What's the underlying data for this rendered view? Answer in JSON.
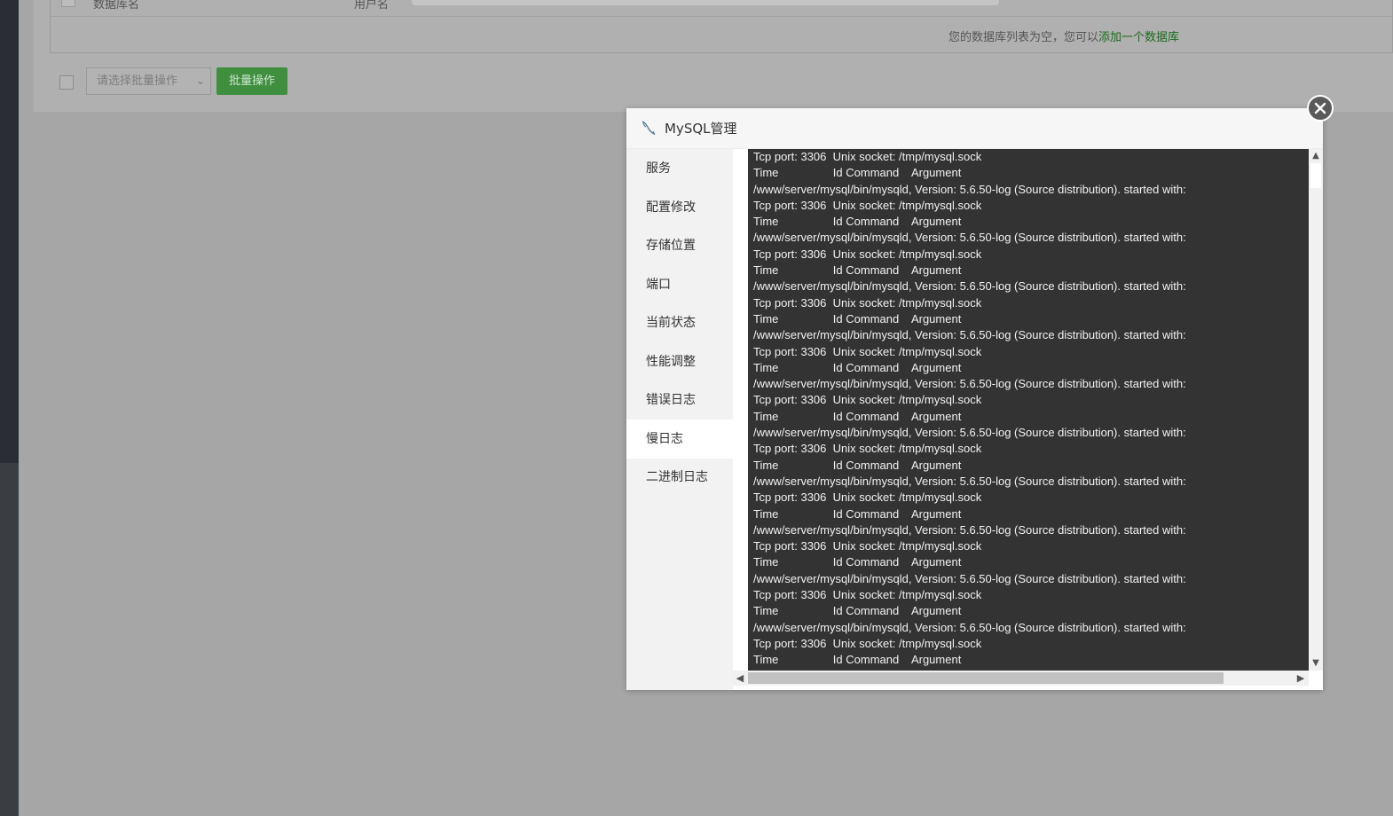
{
  "background": {
    "table": {
      "columns": [
        "数据库名",
        "用户名"
      ],
      "empty_text": "您的数据库列表为空，您可以",
      "empty_link": "添加一个数据库"
    },
    "batch": {
      "select_placeholder": "请选择批量操作",
      "button": "批量操作"
    }
  },
  "modal": {
    "title": "MySQL管理",
    "nav": [
      {
        "label": "服务"
      },
      {
        "label": "配置修改"
      },
      {
        "label": "存储位置"
      },
      {
        "label": "端口"
      },
      {
        "label": "当前状态"
      },
      {
        "label": "性能调整"
      },
      {
        "label": "错误日志"
      },
      {
        "label": "慢日志",
        "active": true
      },
      {
        "label": "二进制日志"
      }
    ],
    "log_lines": [
      "Tcp port: 3306  Unix socket: /tmp/mysql.sock",
      "Time                 Id Command    Argument",
      "/www/server/mysql/bin/mysqld, Version: 5.6.50-log (Source distribution). started with:",
      "Tcp port: 3306  Unix socket: /tmp/mysql.sock",
      "Time                 Id Command    Argument",
      "/www/server/mysql/bin/mysqld, Version: 5.6.50-log (Source distribution). started with:",
      "Tcp port: 3306  Unix socket: /tmp/mysql.sock",
      "Time                 Id Command    Argument",
      "/www/server/mysql/bin/mysqld, Version: 5.6.50-log (Source distribution). started with:",
      "Tcp port: 3306  Unix socket: /tmp/mysql.sock",
      "Time                 Id Command    Argument",
      "/www/server/mysql/bin/mysqld, Version: 5.6.50-log (Source distribution). started with:",
      "Tcp port: 3306  Unix socket: /tmp/mysql.sock",
      "Time                 Id Command    Argument",
      "/www/server/mysql/bin/mysqld, Version: 5.6.50-log (Source distribution). started with:",
      "Tcp port: 3306  Unix socket: /tmp/mysql.sock",
      "Time                 Id Command    Argument",
      "/www/server/mysql/bin/mysqld, Version: 5.6.50-log (Source distribution). started with:",
      "Tcp port: 3306  Unix socket: /tmp/mysql.sock",
      "Time                 Id Command    Argument",
      "/www/server/mysql/bin/mysqld, Version: 5.6.50-log (Source distribution). started with:",
      "Tcp port: 3306  Unix socket: /tmp/mysql.sock",
      "Time                 Id Command    Argument",
      "/www/server/mysql/bin/mysqld, Version: 5.6.50-log (Source distribution). started with:",
      "Tcp port: 3306  Unix socket: /tmp/mysql.sock",
      "Time                 Id Command    Argument",
      "/www/server/mysql/bin/mysqld, Version: 5.6.50-log (Source distribution). started with:",
      "Tcp port: 3306  Unix socket: /tmp/mysql.sock",
      "Time                 Id Command    Argument",
      "/www/server/mysql/bin/mysqld, Version: 5.6.50-log (Source distribution). started with:",
      "Tcp port: 3306  Unix socket: /tmp/mysql.sock",
      "Time                 Id Command    Argument"
    ]
  },
  "colors": {
    "accent_green": "#20a53a",
    "log_bg": "#333333"
  },
  "icons": {
    "modal": "mysql-dolphin-icon",
    "close": "close-icon",
    "scroll_up": "arrow-up-icon",
    "scroll_down": "arrow-down-icon",
    "scroll_left": "arrow-left-icon",
    "scroll_right": "arrow-right-icon"
  }
}
